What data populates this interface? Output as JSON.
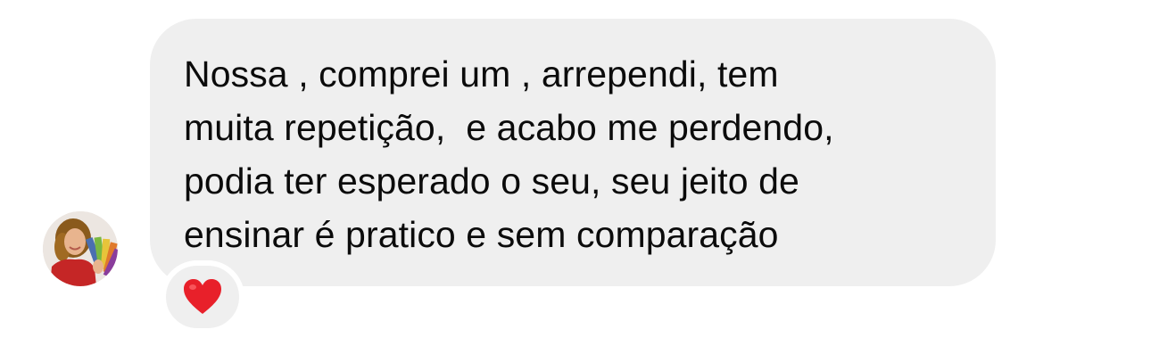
{
  "message": {
    "lines": [
      "Nossa , comprei um , arrependi, tem",
      "muita repetição,  e acabo me perdendo,",
      "podia ter esperado o seu, seu jeito de",
      "ensinar é pratico e sem comparação"
    ],
    "reaction": "heart-emoji"
  },
  "sender": {
    "avatar": "profile-photo"
  },
  "colors": {
    "bubble": "#efefef",
    "text": "#0b0b0b",
    "heart": "#e8202a"
  }
}
